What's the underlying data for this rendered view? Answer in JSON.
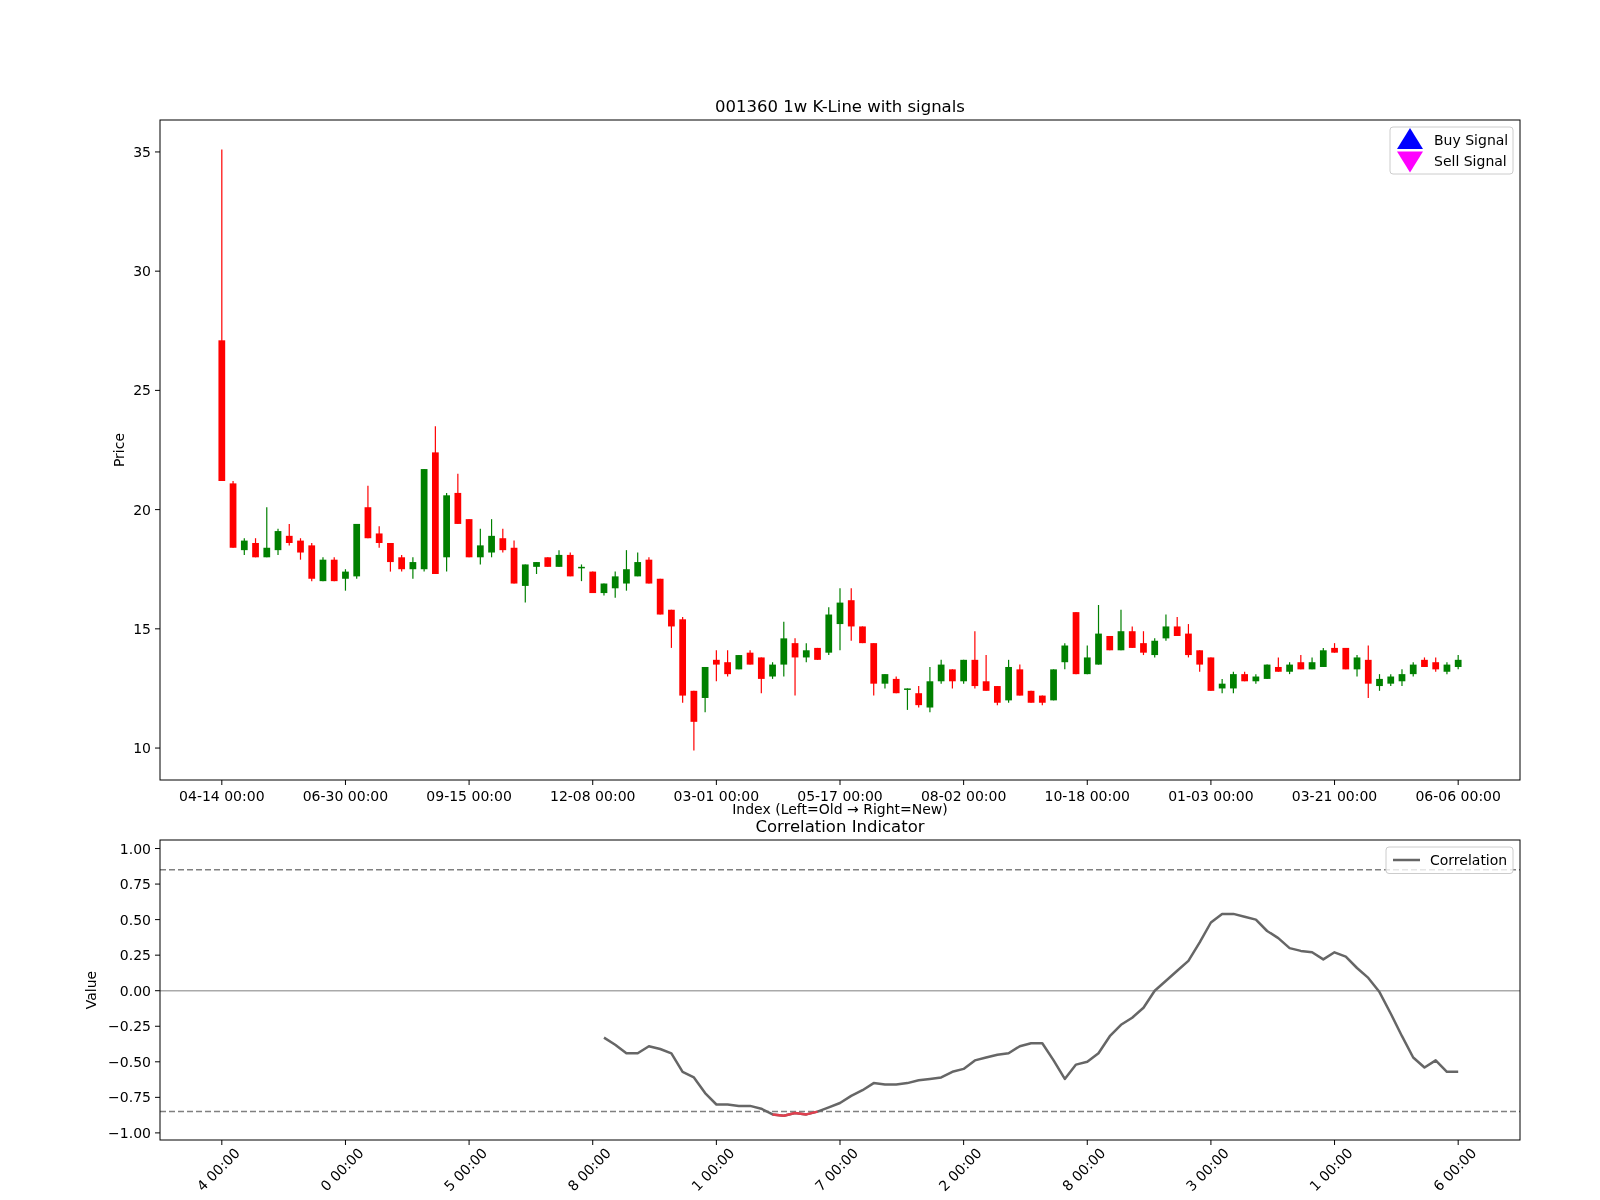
{
  "price_panel": {
    "chart_data": {
      "type": "candlestick",
      "title": "001360 1w K-Line with signals",
      "xlabel": "Index (Left=Old → Right=New)",
      "ylabel": "Price",
      "ylim": [
        8.66,
        36.34
      ],
      "categories": [
        "04-14 00:00",
        null,
        null,
        null,
        null,
        null,
        null,
        null,
        null,
        null,
        null,
        "06-30 00:00",
        null,
        null,
        null,
        null,
        null,
        null,
        null,
        null,
        null,
        null,
        "09-15 00:00",
        null,
        null,
        null,
        null,
        null,
        null,
        null,
        null,
        null,
        null,
        "12-08 00:00",
        null,
        null,
        null,
        null,
        null,
        null,
        null,
        null,
        null,
        null,
        "03-01 00:00",
        null,
        null,
        null,
        null,
        null,
        null,
        null,
        null,
        null,
        null,
        "05-17 00:00",
        null,
        null,
        null,
        null,
        null,
        null,
        null,
        null,
        null,
        null,
        "08-02 00:00",
        null,
        null,
        null,
        null,
        null,
        null,
        null,
        null,
        null,
        null,
        "10-18 00:00",
        null,
        null,
        null,
        null,
        null,
        null,
        null,
        null,
        null,
        null,
        "01-03 00:00",
        null,
        null,
        null,
        null,
        null,
        null,
        null,
        null,
        null,
        null,
        "03-21 00:00",
        null,
        null,
        null,
        null,
        null,
        null,
        null,
        null,
        null,
        null,
        "06-06 00:00"
      ],
      "yticks": [
        10,
        15,
        20,
        25,
        30,
        35
      ],
      "ohlc": [
        [
          27.1,
          35.1,
          21.2,
          21.2
        ],
        [
          21.1,
          21.2,
          18.4,
          18.4
        ],
        [
          18.3,
          18.8,
          18.1,
          18.7
        ],
        [
          18.6,
          18.8,
          18.0,
          18.0
        ],
        [
          18.0,
          20.1,
          18.0,
          18.4
        ],
        [
          18.3,
          19.2,
          18.1,
          19.1
        ],
        [
          18.9,
          19.4,
          18.5,
          18.6
        ],
        [
          18.7,
          18.8,
          17.9,
          18.2
        ],
        [
          18.5,
          18.6,
          17.0,
          17.1
        ],
        [
          17.0,
          18.0,
          17.0,
          17.9
        ],
        [
          17.9,
          18.0,
          17.0,
          17.0
        ],
        [
          17.1,
          17.5,
          16.6,
          17.4
        ],
        [
          17.2,
          19.4,
          17.1,
          19.4
        ],
        [
          20.1,
          21.0,
          18.8,
          18.8
        ],
        [
          19.0,
          19.3,
          18.4,
          18.6
        ],
        [
          18.6,
          18.6,
          17.4,
          17.8
        ],
        [
          18.0,
          18.1,
          17.4,
          17.5
        ],
        [
          17.5,
          18.0,
          17.1,
          17.8
        ],
        [
          17.5,
          21.7,
          17.4,
          21.7
        ],
        [
          22.4,
          23.5,
          17.3,
          17.3
        ],
        [
          18.0,
          20.7,
          17.4,
          20.6
        ],
        [
          20.7,
          21.5,
          19.4,
          19.4
        ],
        [
          19.6,
          19.6,
          18.0,
          18.0
        ],
        [
          18.0,
          19.2,
          17.7,
          18.5
        ],
        [
          18.2,
          19.6,
          18.0,
          18.9
        ],
        [
          18.8,
          19.2,
          18.2,
          18.3
        ],
        [
          18.4,
          18.7,
          16.9,
          16.9
        ],
        [
          16.8,
          17.7,
          16.1,
          17.7
        ],
        [
          17.6,
          17.8,
          17.3,
          17.8
        ],
        [
          18.0,
          18.0,
          17.6,
          17.6
        ],
        [
          17.6,
          18.3,
          17.6,
          18.1
        ],
        [
          18.1,
          18.2,
          17.2,
          17.2
        ],
        [
          17.6,
          17.7,
          17.0,
          17.6
        ],
        [
          17.4,
          17.4,
          16.5,
          16.5
        ],
        [
          16.5,
          16.9,
          16.4,
          16.9
        ],
        [
          16.7,
          17.4,
          16.3,
          17.2
        ],
        [
          16.9,
          18.3,
          16.6,
          17.5
        ],
        [
          17.2,
          18.2,
          17.2,
          17.8
        ],
        [
          17.9,
          18.0,
          16.9,
          16.9
        ],
        [
          17.1,
          17.1,
          15.6,
          15.6
        ],
        [
          15.8,
          15.8,
          14.2,
          15.1
        ],
        [
          15.4,
          15.5,
          11.9,
          12.2
        ],
        [
          12.4,
          12.4,
          9.9,
          11.1
        ],
        [
          12.1,
          13.4,
          11.5,
          13.4
        ],
        [
          13.7,
          14.1,
          12.8,
          13.5
        ],
        [
          13.6,
          14.1,
          13.0,
          13.1
        ],
        [
          13.3,
          13.9,
          13.3,
          13.9
        ],
        [
          14.0,
          14.1,
          13.5,
          13.5
        ],
        [
          13.8,
          13.8,
          12.3,
          12.9
        ],
        [
          13.0,
          13.6,
          12.9,
          13.5
        ],
        [
          13.5,
          15.3,
          13.0,
          14.6
        ],
        [
          14.4,
          14.6,
          12.2,
          13.8
        ],
        [
          13.8,
          14.4,
          13.6,
          14.1
        ],
        [
          14.2,
          14.2,
          13.7,
          13.7
        ],
        [
          14.0,
          15.9,
          13.9,
          15.6
        ],
        [
          15.2,
          16.7,
          14.1,
          16.1
        ],
        [
          16.2,
          16.7,
          14.5,
          15.1
        ],
        [
          15.1,
          15.1,
          14.4,
          14.4
        ],
        [
          14.4,
          14.4,
          12.2,
          12.7
        ],
        [
          12.7,
          13.1,
          12.5,
          13.1
        ],
        [
          12.9,
          13.0,
          12.3,
          12.3
        ],
        [
          12.5,
          12.5,
          11.6,
          12.5
        ],
        [
          12.3,
          12.6,
          11.7,
          11.8
        ],
        [
          11.7,
          13.4,
          11.5,
          12.8
        ],
        [
          12.8,
          13.7,
          12.7,
          13.5
        ],
        [
          13.3,
          13.3,
          12.5,
          12.8
        ],
        [
          12.8,
          13.7,
          12.7,
          13.7
        ],
        [
          13.7,
          14.9,
          12.5,
          12.6
        ],
        [
          12.8,
          13.9,
          12.4,
          12.4
        ],
        [
          12.6,
          12.6,
          11.8,
          11.9
        ],
        [
          12.0,
          13.7,
          11.9,
          13.4
        ],
        [
          13.3,
          13.5,
          12.2,
          12.2
        ],
        [
          12.4,
          12.4,
          11.9,
          11.9
        ],
        [
          12.2,
          12.2,
          11.8,
          11.9
        ],
        [
          12.0,
          13.3,
          12.0,
          13.3
        ],
        [
          13.6,
          14.4,
          13.3,
          14.3
        ],
        [
          15.7,
          15.7,
          13.1,
          13.1
        ],
        [
          13.1,
          14.3,
          13.1,
          13.8
        ],
        [
          13.5,
          16.0,
          13.5,
          14.8
        ],
        [
          14.7,
          14.7,
          14.1,
          14.1
        ],
        [
          14.1,
          15.8,
          14.1,
          14.9
        ],
        [
          14.9,
          15.1,
          14.2,
          14.2
        ],
        [
          14.4,
          14.9,
          13.9,
          14.0
        ],
        [
          13.9,
          14.6,
          13.8,
          14.5
        ],
        [
          14.6,
          15.6,
          14.5,
          15.1
        ],
        [
          15.1,
          15.5,
          14.7,
          14.7
        ],
        [
          14.8,
          15.2,
          13.8,
          13.9
        ],
        [
          14.1,
          14.1,
          13.2,
          13.5
        ],
        [
          13.8,
          13.8,
          12.4,
          12.4
        ],
        [
          12.5,
          12.9,
          12.3,
          12.7
        ],
        [
          12.5,
          13.2,
          12.3,
          13.1
        ],
        [
          13.1,
          13.2,
          12.8,
          12.8
        ],
        [
          12.8,
          13.1,
          12.7,
          13.0
        ],
        [
          12.9,
          13.5,
          12.9,
          13.5
        ],
        [
          13.4,
          13.8,
          13.2,
          13.2
        ],
        [
          13.2,
          13.6,
          13.1,
          13.5
        ],
        [
          13.6,
          13.9,
          13.3,
          13.3
        ],
        [
          13.3,
          13.8,
          13.3,
          13.6
        ],
        [
          13.4,
          14.2,
          13.4,
          14.1
        ],
        [
          14.2,
          14.4,
          14.0,
          14.0
        ],
        [
          14.2,
          14.2,
          13.3,
          13.3
        ],
        [
          13.3,
          13.9,
          13.0,
          13.8
        ],
        [
          13.7,
          14.3,
          12.1,
          12.7
        ],
        [
          12.6,
          13.1,
          12.4,
          12.9
        ],
        [
          12.7,
          13.1,
          12.6,
          13.0
        ],
        [
          12.8,
          13.3,
          12.6,
          13.1
        ],
        [
          13.1,
          13.6,
          13.0,
          13.5
        ],
        [
          13.7,
          13.8,
          13.4,
          13.4
        ],
        [
          13.6,
          13.8,
          13.2,
          13.3
        ],
        [
          13.2,
          13.6,
          13.1,
          13.5
        ],
        [
          13.4,
          13.9,
          13.3,
          13.7
        ]
      ]
    },
    "legend": [
      {
        "label": "Buy Signal",
        "color": "#0000ff",
        "kind": "triangle-up"
      },
      {
        "label": "Sell Signal",
        "color": "#ff00ff",
        "kind": "triangle-down"
      }
    ]
  },
  "correlation_panel": {
    "chart_data": {
      "type": "line",
      "title": "Correlation Indicator",
      "ylabel": "Value",
      "ylim": [
        -1.05,
        1.06
      ],
      "categories": [
        "4 00:00",
        null,
        null,
        null,
        null,
        null,
        null,
        null,
        null,
        null,
        null,
        "0 00:00",
        null,
        null,
        null,
        null,
        null,
        null,
        null,
        null,
        null,
        null,
        "5 00:00",
        null,
        null,
        null,
        null,
        null,
        null,
        null,
        null,
        null,
        null,
        "8 00:00",
        null,
        null,
        null,
        null,
        null,
        null,
        null,
        null,
        null,
        null,
        "1 00:00",
        null,
        null,
        null,
        null,
        null,
        null,
        null,
        null,
        null,
        null,
        "7 00:00",
        null,
        null,
        null,
        null,
        null,
        null,
        null,
        null,
        null,
        null,
        "2 00:00",
        null,
        null,
        null,
        null,
        null,
        null,
        null,
        null,
        null,
        null,
        "8 00:00",
        null,
        null,
        null,
        null,
        null,
        null,
        null,
        null,
        null,
        null,
        "3 00:00",
        null,
        null,
        null,
        null,
        null,
        null,
        null,
        null,
        null,
        null,
        "1 00:00",
        null,
        null,
        null,
        null,
        null,
        null,
        null,
        null,
        null,
        null,
        "6 00:00"
      ],
      "yticks": [
        {
          "value": -1,
          "label": "−1.00"
        },
        {
          "value": -0.75,
          "label": "−0.75"
        },
        {
          "value": -0.5,
          "label": "−0.50"
        },
        {
          "value": -0.25,
          "label": "−0.25"
        },
        {
          "value": 0,
          "label": "0.00"
        },
        {
          "value": 0.25,
          "label": "0.25"
        },
        {
          "value": 0.5,
          "label": "0.50"
        },
        {
          "value": 0.75,
          "label": "0.75"
        },
        {
          "value": 1,
          "label": "1.00"
        }
      ],
      "series": [
        {
          "name": "Correlation",
          "color": "#666666",
          "values": [
            null,
            null,
            null,
            null,
            null,
            null,
            null,
            null,
            null,
            null,
            null,
            null,
            null,
            null,
            null,
            null,
            null,
            null,
            null,
            null,
            null,
            null,
            null,
            null,
            null,
            null,
            null,
            null,
            null,
            null,
            null,
            null,
            null,
            null,
            -0.33,
            -0.38,
            -0.44,
            -0.44,
            -0.39,
            -0.41,
            -0.44,
            -0.57,
            -0.61,
            -0.72,
            -0.8,
            -0.8,
            -0.81,
            -0.81,
            -0.83,
            -0.87,
            -0.88,
            -0.86,
            -0.87,
            -0.85,
            -0.82,
            -0.79,
            -0.74,
            -0.7,
            -0.65,
            -0.66,
            -0.66,
            -0.65,
            -0.63,
            -0.62,
            -0.61,
            -0.57,
            -0.55,
            -0.49,
            -0.47,
            -0.45,
            -0.44,
            -0.39,
            -0.37,
            -0.37,
            -0.49,
            -0.62,
            -0.52,
            -0.5,
            -0.44,
            -0.32,
            -0.24,
            -0.19,
            -0.12,
            0.0,
            0.07,
            0.14,
            0.21,
            0.34,
            0.48,
            0.54,
            0.54,
            0.52,
            0.5,
            0.42,
            0.37,
            0.3,
            0.28,
            0.27,
            0.22,
            0.27,
            0.24,
            0.16,
            0.09,
            -0.01,
            -0.16,
            -0.32,
            -0.47,
            -0.54,
            -0.49,
            -0.57,
            -0.57
          ]
        },
        {
          "color": "#e0404f",
          "values": [
            null,
            null,
            null,
            null,
            null,
            null,
            null,
            null,
            null,
            null,
            null,
            null,
            null,
            null,
            null,
            null,
            null,
            null,
            null,
            null,
            null,
            null,
            null,
            null,
            null,
            null,
            null,
            null,
            null,
            null,
            null,
            null,
            null,
            null,
            null,
            null,
            null,
            null,
            null,
            null,
            null,
            null,
            null,
            null,
            null,
            null,
            null,
            null,
            null,
            -0.87,
            -0.88,
            -0.86,
            -0.87,
            -0.85,
            null,
            null,
            null,
            null,
            null,
            null,
            null,
            null,
            null,
            null,
            null,
            null,
            null,
            null,
            null,
            null,
            null,
            null,
            null,
            null,
            null,
            null,
            null,
            null,
            null,
            null,
            null,
            null,
            null,
            null,
            null,
            null,
            null,
            null,
            null,
            null,
            null,
            null,
            null,
            null,
            null,
            null,
            null,
            null,
            null,
            null,
            null,
            null,
            null,
            null,
            null,
            null,
            null,
            null,
            null,
            null,
            null
          ]
        }
      ],
      "ref_lines": [
        {
          "axis": "y",
          "value": 0.85,
          "color": "#808080"
        },
        {
          "axis": "y",
          "value": -0.85,
          "color": "#808080"
        },
        {
          "axis": "y",
          "value": 0,
          "color": "#aaaaaa"
        }
      ]
    }
  }
}
